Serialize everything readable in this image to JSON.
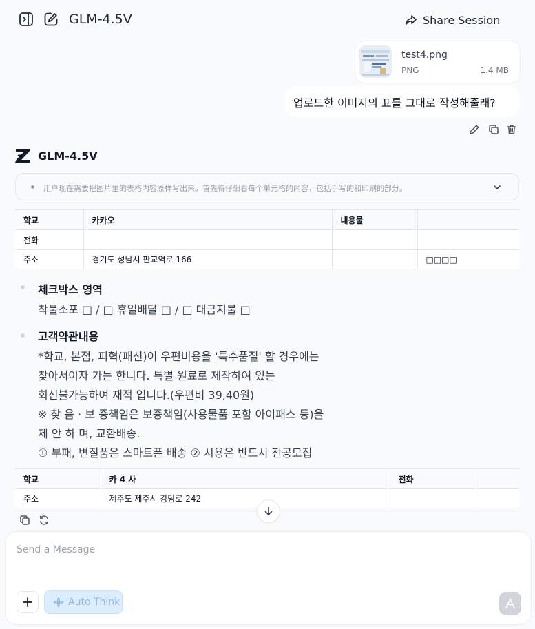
{
  "header": {
    "title": "GLM-4.5V",
    "share_label": "Share Session",
    "icons": [
      "sidebar-toggle-icon",
      "new-chat-icon",
      "share-icon"
    ]
  },
  "attachment": {
    "file_name": "test4.png",
    "file_type": "PNG",
    "file_size": "1.4 MB"
  },
  "user_message": "업로드한 이미지의 표를 그대로 작성해줄래?",
  "message_actions": [
    "edit-icon",
    "copy-icon",
    "delete-icon"
  ],
  "assistant": {
    "model_name": "GLM-4.5V",
    "thinking_summary": "用户现在需要把图片里的表格内容原样写出来。首先得仔细看每个单元格的内容，包括手写的和印刷的部分。",
    "table1": {
      "headers": [
        "학교",
        "카카오",
        "내용물",
        ""
      ],
      "rows": [
        [
          "전화",
          "",
          "",
          ""
        ],
        [
          "주소",
          "경기도 성남시 판교역로 166",
          "",
          "□□□□"
        ]
      ]
    },
    "bullets": [
      {
        "title": "체크박스 영역",
        "lines": [
          "착불소포 □ / □ 휴일배달 □ / □ 대금지불 □"
        ]
      },
      {
        "title": "고객약관내용",
        "lines": [
          "*학교, 본점, 피혁(패션)이 우편비용을 '특수품질' 할 경우에는",
          "찾아서이자 가는 한니다. 특별 원료로 제작하여 있는",
          "회신불가능하여 재적 입니다.(우편비 39,40원)",
          "※ 찾 음 · 보 증책임은 보증책임(사용물품 포함 아이패스 등)을",
          "제 안 하 며, 교환배송.",
          "① 부패, 변질품은 스마트폰 배송 ② 시용은 반드시 전공모집"
        ]
      }
    ],
    "table2": {
      "headers": [
        "학교",
        "카 4 사",
        "전화",
        ""
      ],
      "rows": [
        [
          "주소",
          "제주도 제주시 강당로 242",
          "",
          ""
        ]
      ]
    }
  },
  "response_actions": [
    "copy-icon",
    "regenerate-icon"
  ],
  "composer": {
    "placeholder": "Send a Message",
    "auto_think_label": "Auto Think"
  },
  "colors": {
    "background": "#f9fafb",
    "auto_think_bg": "#dceefe",
    "auto_think_text": "#93b9e0",
    "send_disabled": "#d1d5db"
  }
}
